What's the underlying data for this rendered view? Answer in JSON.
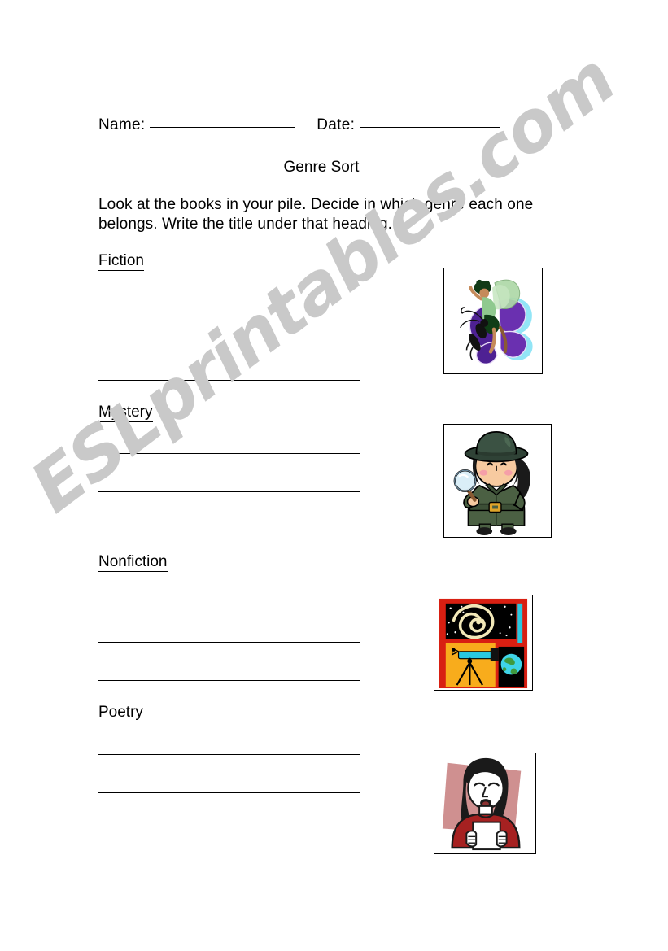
{
  "document": {
    "header": {
      "name_label": "Name:",
      "date_label": "Date:"
    },
    "title": "Genre Sort",
    "instructions": "Look at the books in your pile.  Decide in which genre each one belongs.  Write the title under that heading.",
    "sections": [
      {
        "heading": "Fiction",
        "lines": 3,
        "image_alt": "butterfly-fairy"
      },
      {
        "heading": "Mystery",
        "lines": 3,
        "image_alt": "detective-girl"
      },
      {
        "heading": "Nonfiction",
        "lines": 3,
        "image_alt": "telescope-galaxy-globe"
      },
      {
        "heading": "Poetry",
        "lines": 2,
        "image_alt": "person-reading-poem"
      }
    ],
    "watermark": "ESLprintables.com",
    "colors": {
      "ink": "#000000",
      "watermark": "#c9c9c9",
      "page": "#ffffff",
      "butterfly_wing": "#6a30b0",
      "butterfly_glow": "#5fd4ef",
      "fairy_dress": "#8fc98f",
      "detective_coat": "#4b6043",
      "detective_hat": "#2f4236",
      "detective_skin": "#f5c9a0",
      "detective_hair": "#1a1a1a",
      "detective_buckle": "#e0a52a",
      "science_red": "#d81f12",
      "science_orange": "#f8ac1c",
      "science_space": "#000000",
      "science_galaxy": "#f2e8b8",
      "science_cyan": "#29c8e0",
      "science_globe_blue": "#3fd4e8",
      "science_globe_green": "#3f9a3f",
      "poet_sweater": "#a62121",
      "poet_backdrop": "#cf9090",
      "poet_hair": "#1a1a1a",
      "poet_paper": "#ffffff"
    }
  }
}
